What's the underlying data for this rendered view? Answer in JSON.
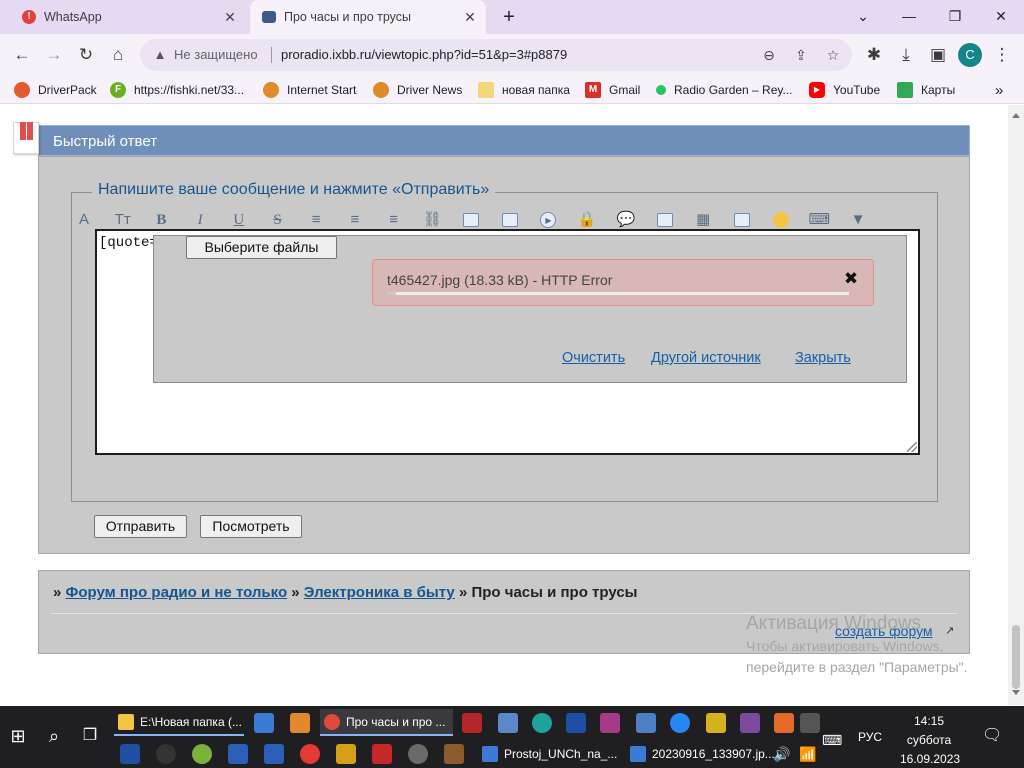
{
  "browser": {
    "tabs": [
      {
        "title": "WhatsApp",
        "icon": "whatsapp-alert-icon",
        "icon_glyph": "!"
      },
      {
        "title": "Про часы и про трусы",
        "icon": "forum-icon"
      }
    ],
    "new_tab_glyph": "+",
    "tab_close_glyph": "✕",
    "window_controls": {
      "list": "⌄",
      "minimize": "—",
      "restore": "❐",
      "close": "✕"
    },
    "nav": {
      "back": "←",
      "forward": "→",
      "reload": "↻",
      "home": "⌂"
    },
    "security_label": "Не защищено",
    "security_glyph": "▲",
    "url": "proradio.ixbb.ru/viewtopic.php?id=51&p=3#p8879",
    "omni_icons": {
      "zoom": "⊖",
      "share": "⇪",
      "star": "☆"
    },
    "toolbar_icons": {
      "extensions": "✱",
      "download": "⤓",
      "sidepanel": "▣",
      "menu": "⋮"
    },
    "profile_initial": "C",
    "bookmarks": [
      {
        "label": "DriverPack",
        "icon": "driverpack-icon",
        "color": "#e35a2b"
      },
      {
        "label": "https://fishki.net/33...",
        "icon": "fishki-icon",
        "color": "#6ab023",
        "glyph": "F"
      },
      {
        "label": "Internet Start",
        "icon": "internet-start-icon",
        "color": "#e08a2a"
      },
      {
        "label": "Driver News",
        "icon": "driver-news-icon",
        "color": "#e08a2a"
      },
      {
        "label": "новая папка",
        "icon": "folder-icon",
        "color": "#f4d57a"
      },
      {
        "label": "Gmail",
        "icon": "gmail-icon",
        "color": "#d93025",
        "glyph": "M"
      },
      {
        "label": "Radio Garden – Rey...",
        "icon": "radio-garden-icon",
        "color": "#22c55e"
      },
      {
        "label": "YouTube",
        "icon": "youtube-icon",
        "color": "#ff0000",
        "glyph": "▶"
      },
      {
        "label": "Карты",
        "icon": "maps-icon",
        "color": "#34a853"
      }
    ],
    "more_bookmarks": "»"
  },
  "forum": {
    "reply_title": "Быстрый ответ",
    "legend": "Напишите ваше сообщение и нажмите «Отправить»",
    "editor_tools": [
      {
        "name": "font-color-icon",
        "glyph": "A"
      },
      {
        "name": "font-size-icon",
        "glyph": "Tт"
      },
      {
        "name": "bold-icon",
        "glyph": "B",
        "cls": "b"
      },
      {
        "name": "italic-icon",
        "glyph": "I",
        "cls": "i"
      },
      {
        "name": "underline-icon",
        "glyph": "U",
        "cls": "u"
      },
      {
        "name": "strikethrough-icon",
        "glyph": "S",
        "cls": "s"
      },
      {
        "name": "align-left-icon",
        "glyph": "≡"
      },
      {
        "name": "align-center-icon",
        "glyph": "≡"
      },
      {
        "name": "align-right-icon",
        "glyph": "≡"
      },
      {
        "name": "link-icon",
        "glyph": "⛓"
      },
      {
        "name": "image-icon",
        "shape": "bx"
      },
      {
        "name": "gallery-icon",
        "shape": "bx"
      },
      {
        "name": "video-icon",
        "glyph": "▶",
        "shape": "circ"
      },
      {
        "name": "hide-lock-icon",
        "glyph": "🔒"
      },
      {
        "name": "quote-icon",
        "glyph": "💬"
      },
      {
        "name": "upload-icon",
        "shape": "bx"
      },
      {
        "name": "color-palette-icon",
        "glyph": "▦"
      },
      {
        "name": "table-icon",
        "shape": "bx"
      },
      {
        "name": "smiley-icon",
        "shape": "smile"
      },
      {
        "name": "keyboard-icon",
        "glyph": "⌨"
      },
      {
        "name": "more-dropdown-icon",
        "glyph": "▼"
      }
    ],
    "textarea_text": "[quote=",
    "choose_files_button": "Выберите файлы",
    "upload_item": {
      "filename": "t465427.jpg (18.33 kB) - HTTP Error",
      "close_glyph": "✖",
      "progress": 0.02
    },
    "upload_links": {
      "clear": "Очистить",
      "other_source": "Другой источник",
      "close": "Закрыть"
    },
    "submit_button": "Отправить",
    "preview_button": "Посмотреть",
    "breadcrumb": {
      "sep": "»",
      "forum": "Форум про радио и не только",
      "section": "Электроника в быту",
      "topic": "Про часы и про трусы"
    },
    "create_forum": "создать форум",
    "create_forum_arrow": "↗"
  },
  "watermark": {
    "line1": "Активация Windows",
    "line2": "Чтобы активировать Windows,",
    "line3": "перейдите в раздел \"Параметры\"."
  },
  "taskbar": {
    "start_glyph": "⊞",
    "search_glyph": "⌕",
    "taskview_glyph": "❐",
    "apps_row1": [
      {
        "label": "E:\\Новая папка (...",
        "icon": "explorer-folder-icon",
        "color": "#f4c542"
      },
      {
        "label": "Про часы и про ...",
        "icon": "chrome-icon",
        "color": "#e04a3a",
        "active": true
      }
    ],
    "apps_row2": [
      {
        "label": "Prostoj_UNCh_na_...",
        "icon": "document-icon",
        "color": "#3a7bd5"
      },
      {
        "label": "20230916_133907.jp...",
        "icon": "image-viewer-icon",
        "color": "#3a7bd5"
      }
    ],
    "time": "14:15",
    "day": "суббота",
    "date": "16.09.2023",
    "language": "РУС",
    "notification_glyph": "🗨"
  }
}
